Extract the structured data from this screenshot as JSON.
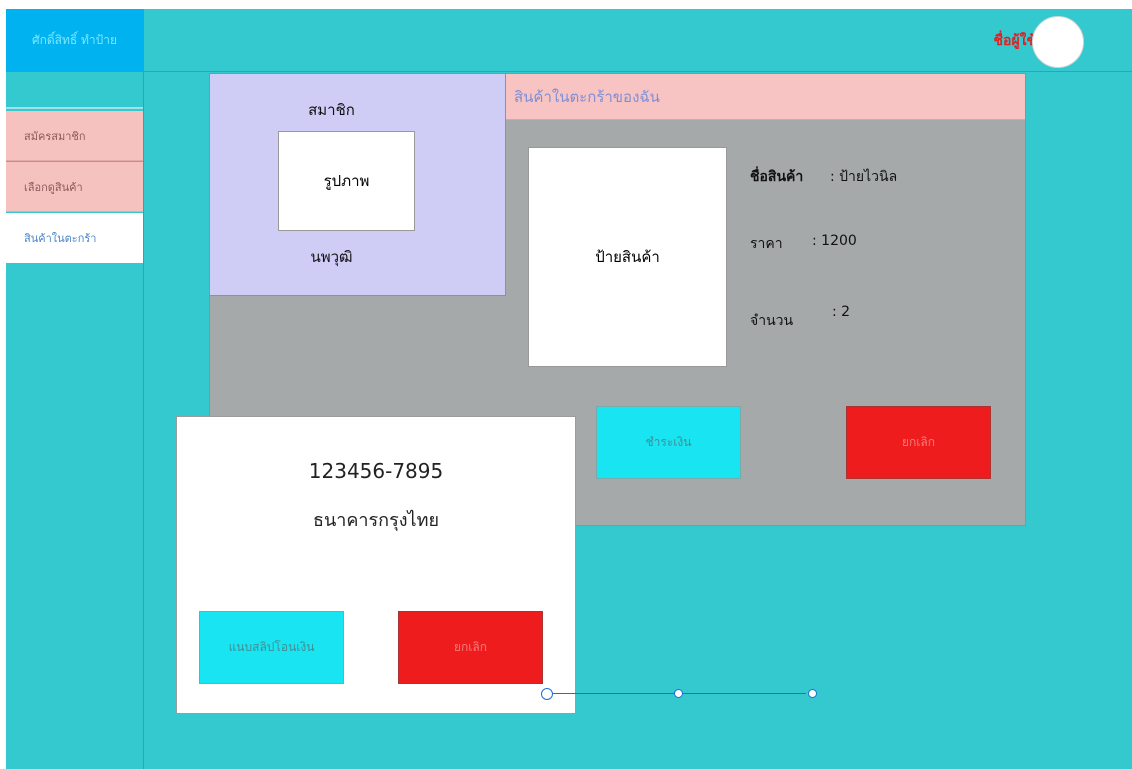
{
  "app": {
    "logo_text": "ศักดิ์สิทธิ์ ทำป้าย"
  },
  "header": {
    "username": "ชื่อผู้ใช้"
  },
  "sidebar": {
    "items": [
      {
        "label": "สมัครสมาชิก"
      },
      {
        "label": "เลือกดูสินค้า"
      },
      {
        "label": "สินค้าในตะกร้า"
      }
    ]
  },
  "member": {
    "title": "สมาชิก",
    "photo_label": "รูปภาพ",
    "name": "นพวุฒิ"
  },
  "cart": {
    "header": "สินค้าในตะกร้าของฉัน",
    "product_image_label": "ป้ายสินค้า",
    "name_label": "ชื่อสินค้า",
    "name_value": ": ป้ายไวนิล",
    "price_label": "ราคา",
    "price_value": ": 1200",
    "qty_label": "จำนวน",
    "qty_value": ": 2",
    "pay_label": "ชำระเงิน",
    "cancel_label": "ยกเลิก"
  },
  "payment_modal": {
    "account_number": "123456-7895",
    "bank_name": "ธนาคารกรุงไทย",
    "attach_label": "แนบสลิปโอนเงิน",
    "cancel_label": "ยกเลิก"
  },
  "slider": {
    "steps": 3,
    "current_step": 1
  },
  "colors": {
    "background": "#33c9cf",
    "logo_bg": "#00b3f0",
    "pink": "#f5c2c0",
    "lavender": "#cfccf5",
    "panel_gray": "#a5a9aa",
    "cyan_button": "#19e5f2",
    "red_button": "#ee1c1c",
    "username_red": "#e02020"
  }
}
